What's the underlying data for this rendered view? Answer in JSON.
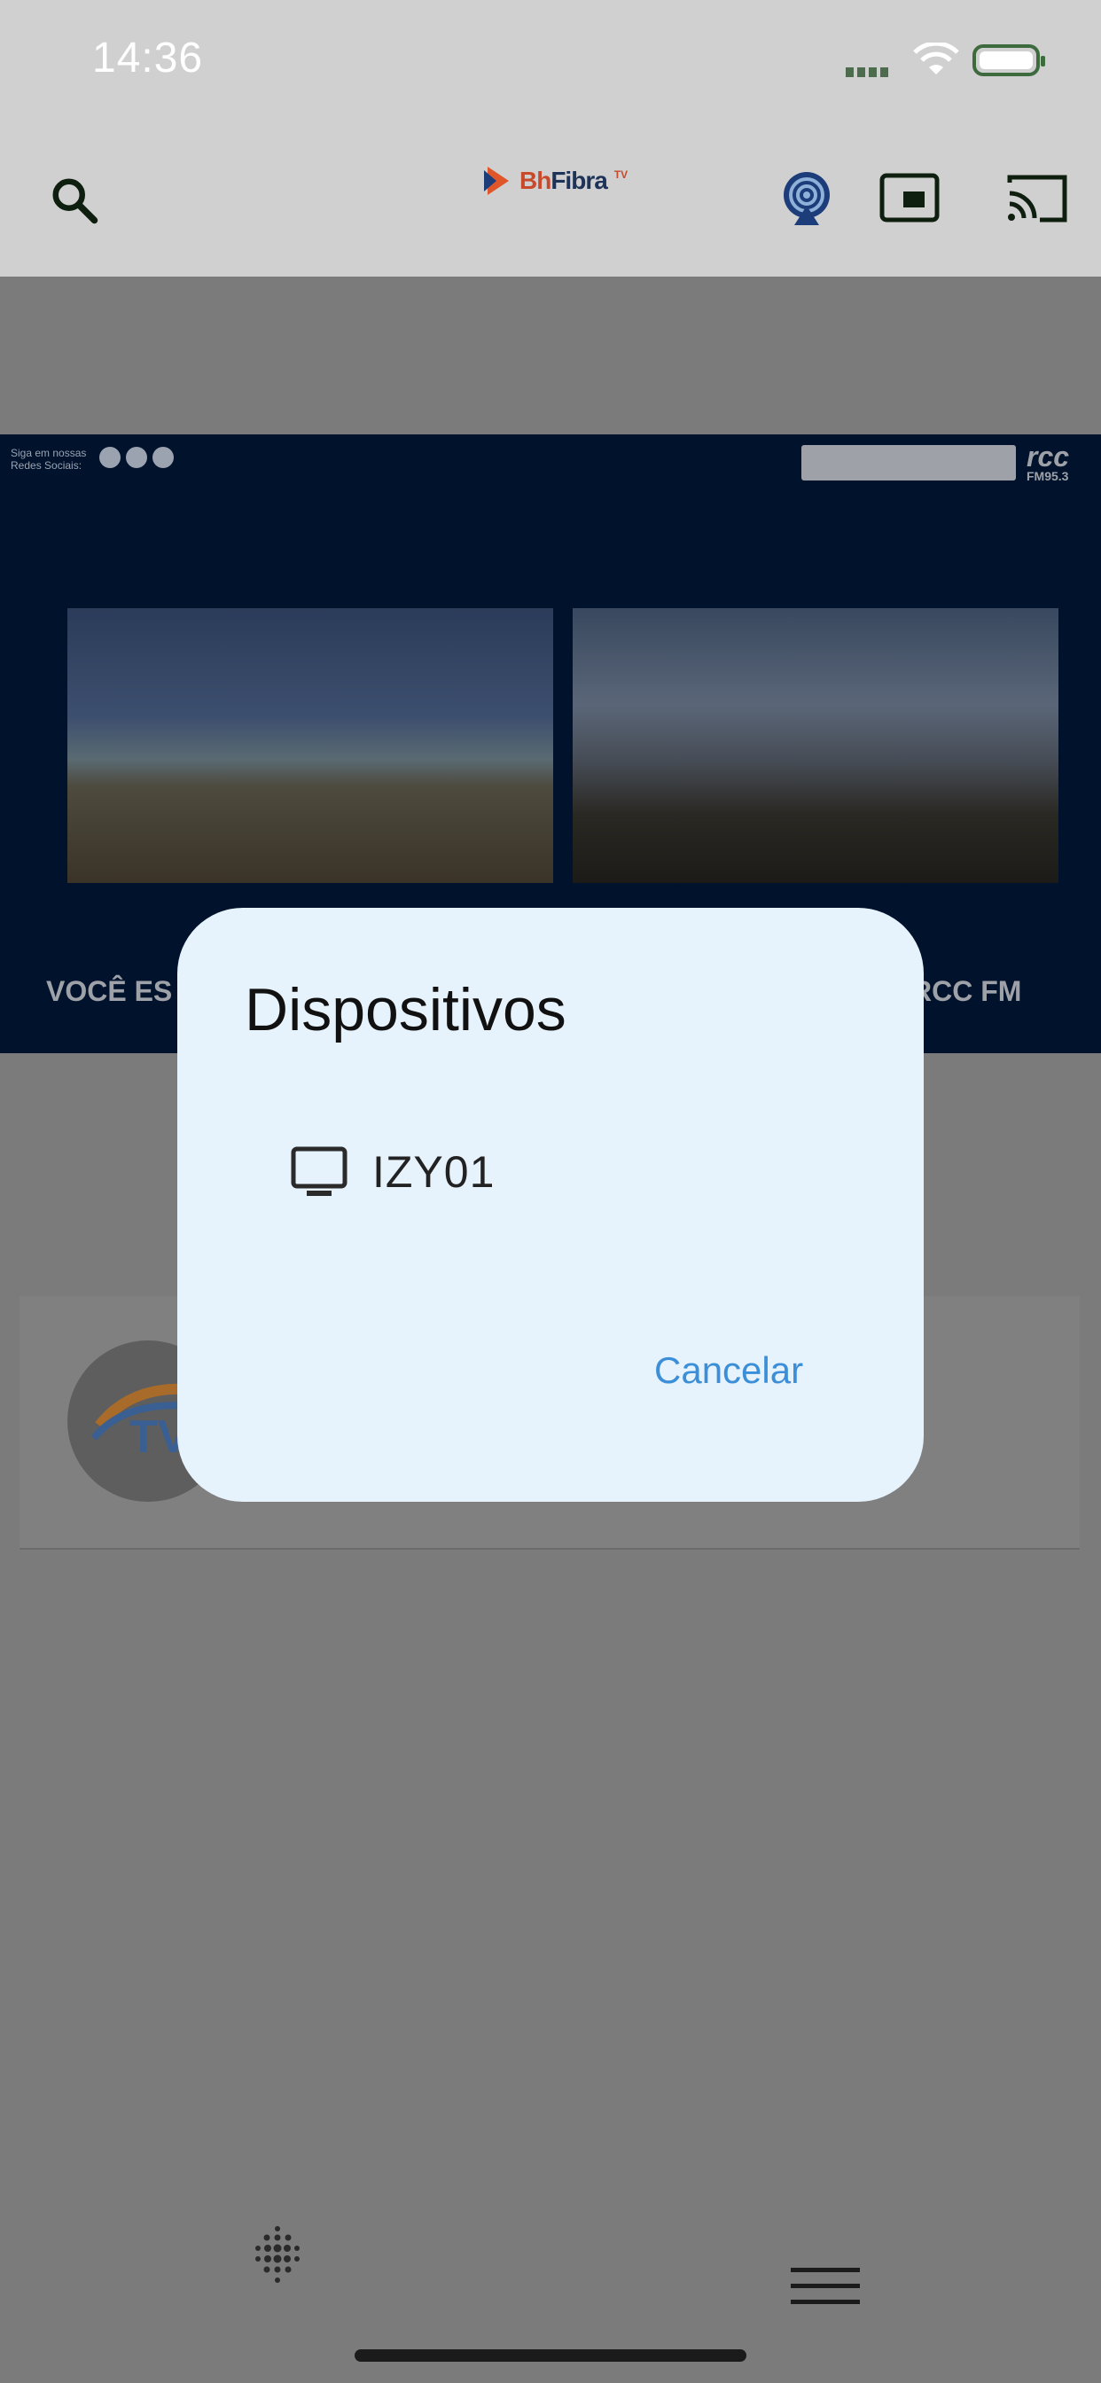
{
  "status_bar": {
    "time": "14:36"
  },
  "app_bar": {
    "logo": {
      "prefix": "Bh",
      "name": "Fibra",
      "suffix": "TV"
    },
    "icons": [
      "search-icon",
      "broadcast-icon",
      "picture-in-picture-icon",
      "cast-icon"
    ]
  },
  "banner": {
    "social_label": "Siga em nossas Redes Sociais:",
    "social_icons": [
      "facebook-icon",
      "instagram-icon",
      "spotify-icon"
    ],
    "brand": {
      "name": "rcc",
      "frequency": "FM95.3"
    },
    "ticker_left": "VOCÊ ES",
    "ticker_right": "RCC FM"
  },
  "dialog": {
    "title": "Dispositivos",
    "devices": [
      {
        "name": "IZY01",
        "icon": "tv-icon"
      }
    ],
    "cancel_label": "Cancelar"
  },
  "bottom_bar": {
    "icons": [
      "dots-grid-icon",
      "menu-icon"
    ]
  },
  "colors": {
    "accent": "#3b8ed8",
    "dialog_bg": "#e6f2fc",
    "banner_bg": "#01122d"
  }
}
